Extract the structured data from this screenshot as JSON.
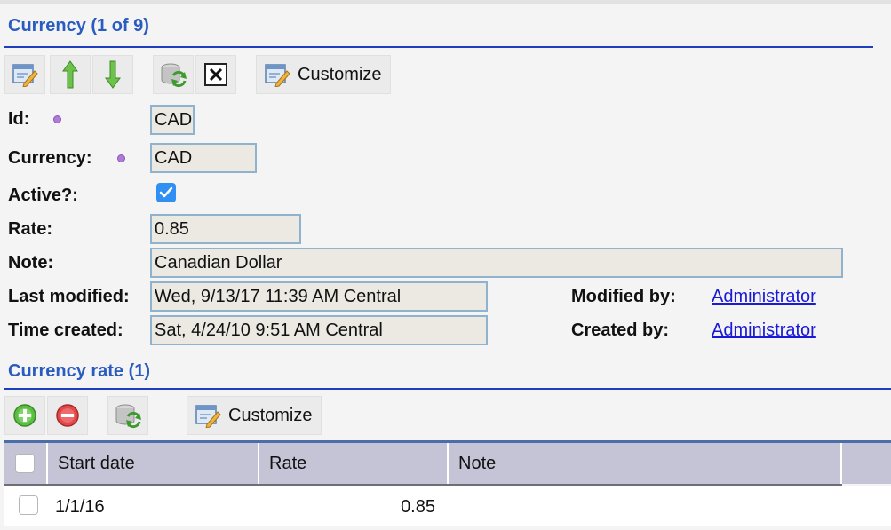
{
  "currency_section": {
    "title": "Currency (1 of 9)",
    "toolbar": {
      "customize_label": "Customize"
    }
  },
  "form": {
    "id": {
      "label": "Id:",
      "value": "CAD"
    },
    "currency": {
      "label": "Currency:",
      "value": "CAD"
    },
    "active": {
      "label": "Active?:",
      "checked": true
    },
    "rate": {
      "label": "Rate:",
      "value": "0.85"
    },
    "note": {
      "label": "Note:",
      "value": "Canadian Dollar"
    },
    "last_modified": {
      "label": "Last modified:",
      "value": "Wed, 9/13/17 11:39 AM Central"
    },
    "time_created": {
      "label": "Time created:",
      "value": "Sat, 4/24/10 9:51 AM Central"
    },
    "modified_by": {
      "label": "Modified by:",
      "value": "Administrator"
    },
    "created_by": {
      "label": "Created by:",
      "value": "Administrator"
    }
  },
  "rate_section": {
    "title": "Currency rate (1)",
    "toolbar": {
      "customize_label": "Customize"
    }
  },
  "grid": {
    "columns": [
      "Start date",
      "Rate",
      "Note"
    ],
    "rows": [
      {
        "start_date": "1/1/16",
        "rate": "0.85",
        "note": ""
      }
    ]
  },
  "colors": {
    "section_title": "#2a5cc0",
    "rule": "#1f3fbf",
    "link": "#1a1ad6",
    "required_dot": "#b07ad8",
    "checkbox": "#2f8ff2",
    "grid_header": "#c4c4d6"
  },
  "icons": {
    "edit": "edit-form-icon",
    "up": "arrow-up-icon",
    "down": "arrow-down-icon",
    "refresh": "refresh-icon",
    "close": "close-box-icon",
    "customize": "customize-icon",
    "add": "add-circle-icon",
    "remove": "remove-circle-icon"
  }
}
